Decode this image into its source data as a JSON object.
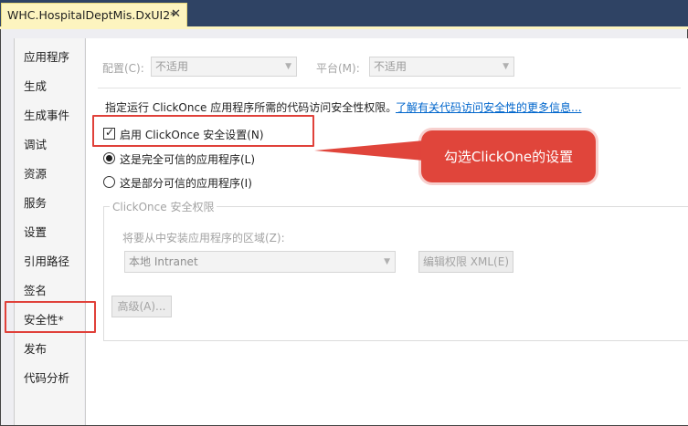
{
  "tab": {
    "title": "WHC.HospitalDeptMis.DxUI2*",
    "close_glyph": "✕"
  },
  "sidebar": {
    "items": [
      {
        "label": "应用程序"
      },
      {
        "label": "生成"
      },
      {
        "label": "生成事件"
      },
      {
        "label": "调试"
      },
      {
        "label": "资源"
      },
      {
        "label": "服务"
      },
      {
        "label": "设置"
      },
      {
        "label": "引用路径"
      },
      {
        "label": "签名"
      },
      {
        "label": "安全性*"
      },
      {
        "label": "发布"
      },
      {
        "label": "代码分析"
      }
    ],
    "selected": "安全性*"
  },
  "config": {
    "label": "配置(C):",
    "value": "不适用"
  },
  "platform": {
    "label": "平台(M):",
    "value": "不适用"
  },
  "description": {
    "text": "指定运行 ClickOnce 应用程序所需的代码访问安全性权限。",
    "link": "了解有关代码访问安全性的更多信息..."
  },
  "enable_checkbox": {
    "label": "启用 ClickOnce 安全设置(N)",
    "checked": true
  },
  "full_trust": {
    "label": "这是完全可信的应用程序(L)",
    "selected": true
  },
  "partial_trust": {
    "label": "这是部分可信的应用程序(I)",
    "selected": false
  },
  "group": {
    "title": "ClickOnce 安全权限"
  },
  "zone": {
    "label": "将要从中安装应用程序的区域(Z):",
    "value": "本地 Intranet"
  },
  "buttons": {
    "edit_xml": "编辑权限 XML(E)",
    "advanced": "高级(A)..."
  },
  "callout": {
    "text": "勾选ClickOne的设置"
  },
  "colors": {
    "accent_red": "#e0413a",
    "tab_bg": "#fdf4bf",
    "link": "#0066cc"
  }
}
